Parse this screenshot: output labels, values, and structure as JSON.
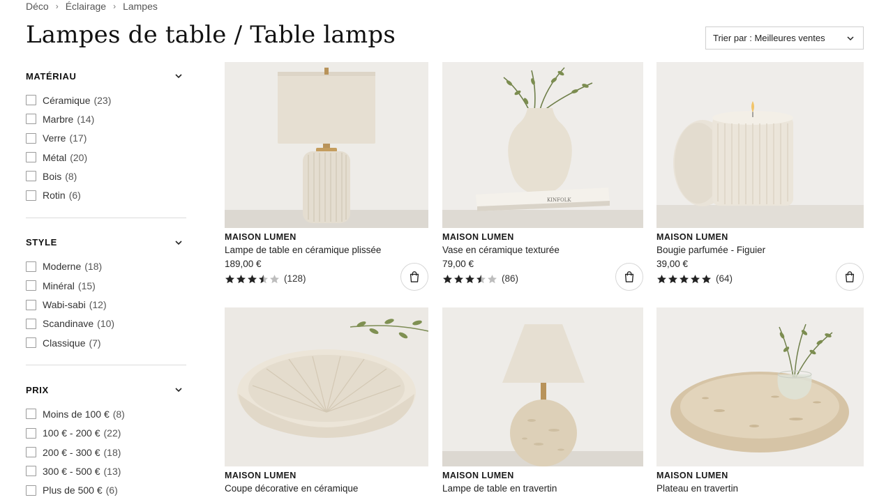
{
  "breadcrumb": [
    "Déco",
    "Éclairage",
    "Lampes"
  ],
  "page_title": "Lampes de table / Table lamps",
  "sort": {
    "label": "Trier par : Meilleures ventes"
  },
  "filters": [
    {
      "title": "MATÉRIAU",
      "options": [
        {
          "label": "Céramique",
          "count": "(23)"
        },
        {
          "label": "Marbre",
          "count": "(14)"
        },
        {
          "label": "Verre",
          "count": "(17)"
        },
        {
          "label": "Métal",
          "count": "(20)"
        },
        {
          "label": "Bois",
          "count": "(8)"
        },
        {
          "label": "Rotin",
          "count": "(6)"
        }
      ]
    },
    {
      "title": "STYLE",
      "options": [
        {
          "label": "Moderne",
          "count": "(18)"
        },
        {
          "label": "Minéral",
          "count": "(15)"
        },
        {
          "label": "Wabi-sabi",
          "count": "(12)"
        },
        {
          "label": "Scandinave",
          "count": "(10)"
        },
        {
          "label": "Classique",
          "count": "(7)"
        }
      ]
    },
    {
      "title": "PRIX",
      "options": [
        {
          "label": "Moins de 100 €",
          "count": "(8)"
        },
        {
          "label": "100 € - 200 €",
          "count": "(22)"
        },
        {
          "label": "200 € - 300 €",
          "count": "(18)"
        },
        {
          "label": "300 € - 500 €",
          "count": "(13)"
        },
        {
          "label": "Plus de 500 €",
          "count": "(6)"
        }
      ]
    }
  ],
  "products": [
    {
      "brand": "MAISON LUMEN",
      "name": "Lampe de table en céramique plissée",
      "price": "189,00 €",
      "rating": 3.5,
      "reviews": "(128)",
      "image": "pleated-ceramic-table-lamp"
    },
    {
      "brand": "MAISON LUMEN",
      "name": "Vase en céramique texturée",
      "price": "79,00 €",
      "rating": 3.5,
      "reviews": "(86)",
      "image": "textured-ceramic-vase",
      "book_text": "KINFOLK"
    },
    {
      "brand": "MAISON LUMEN",
      "name": "Bougie parfumée - Figuier",
      "price": "39,00 €",
      "rating": 5,
      "reviews": "(64)",
      "image": "fluted-scented-candle"
    },
    {
      "brand": "MAISON LUMEN",
      "name": "Coupe décorative en céramique",
      "image": "fluted-ceramic-bowl"
    },
    {
      "brand": "MAISON LUMEN",
      "name": "Lampe de table en travertin",
      "image": "travertine-table-lamp"
    },
    {
      "brand": "MAISON LUMEN",
      "name": "Plateau en travertin",
      "image": "travertine-tray"
    }
  ],
  "colors": {
    "star": "#222222",
    "star_empty": "#bdbdbd",
    "ceramic": "#e8e1d4",
    "background": "#f0eeea"
  }
}
